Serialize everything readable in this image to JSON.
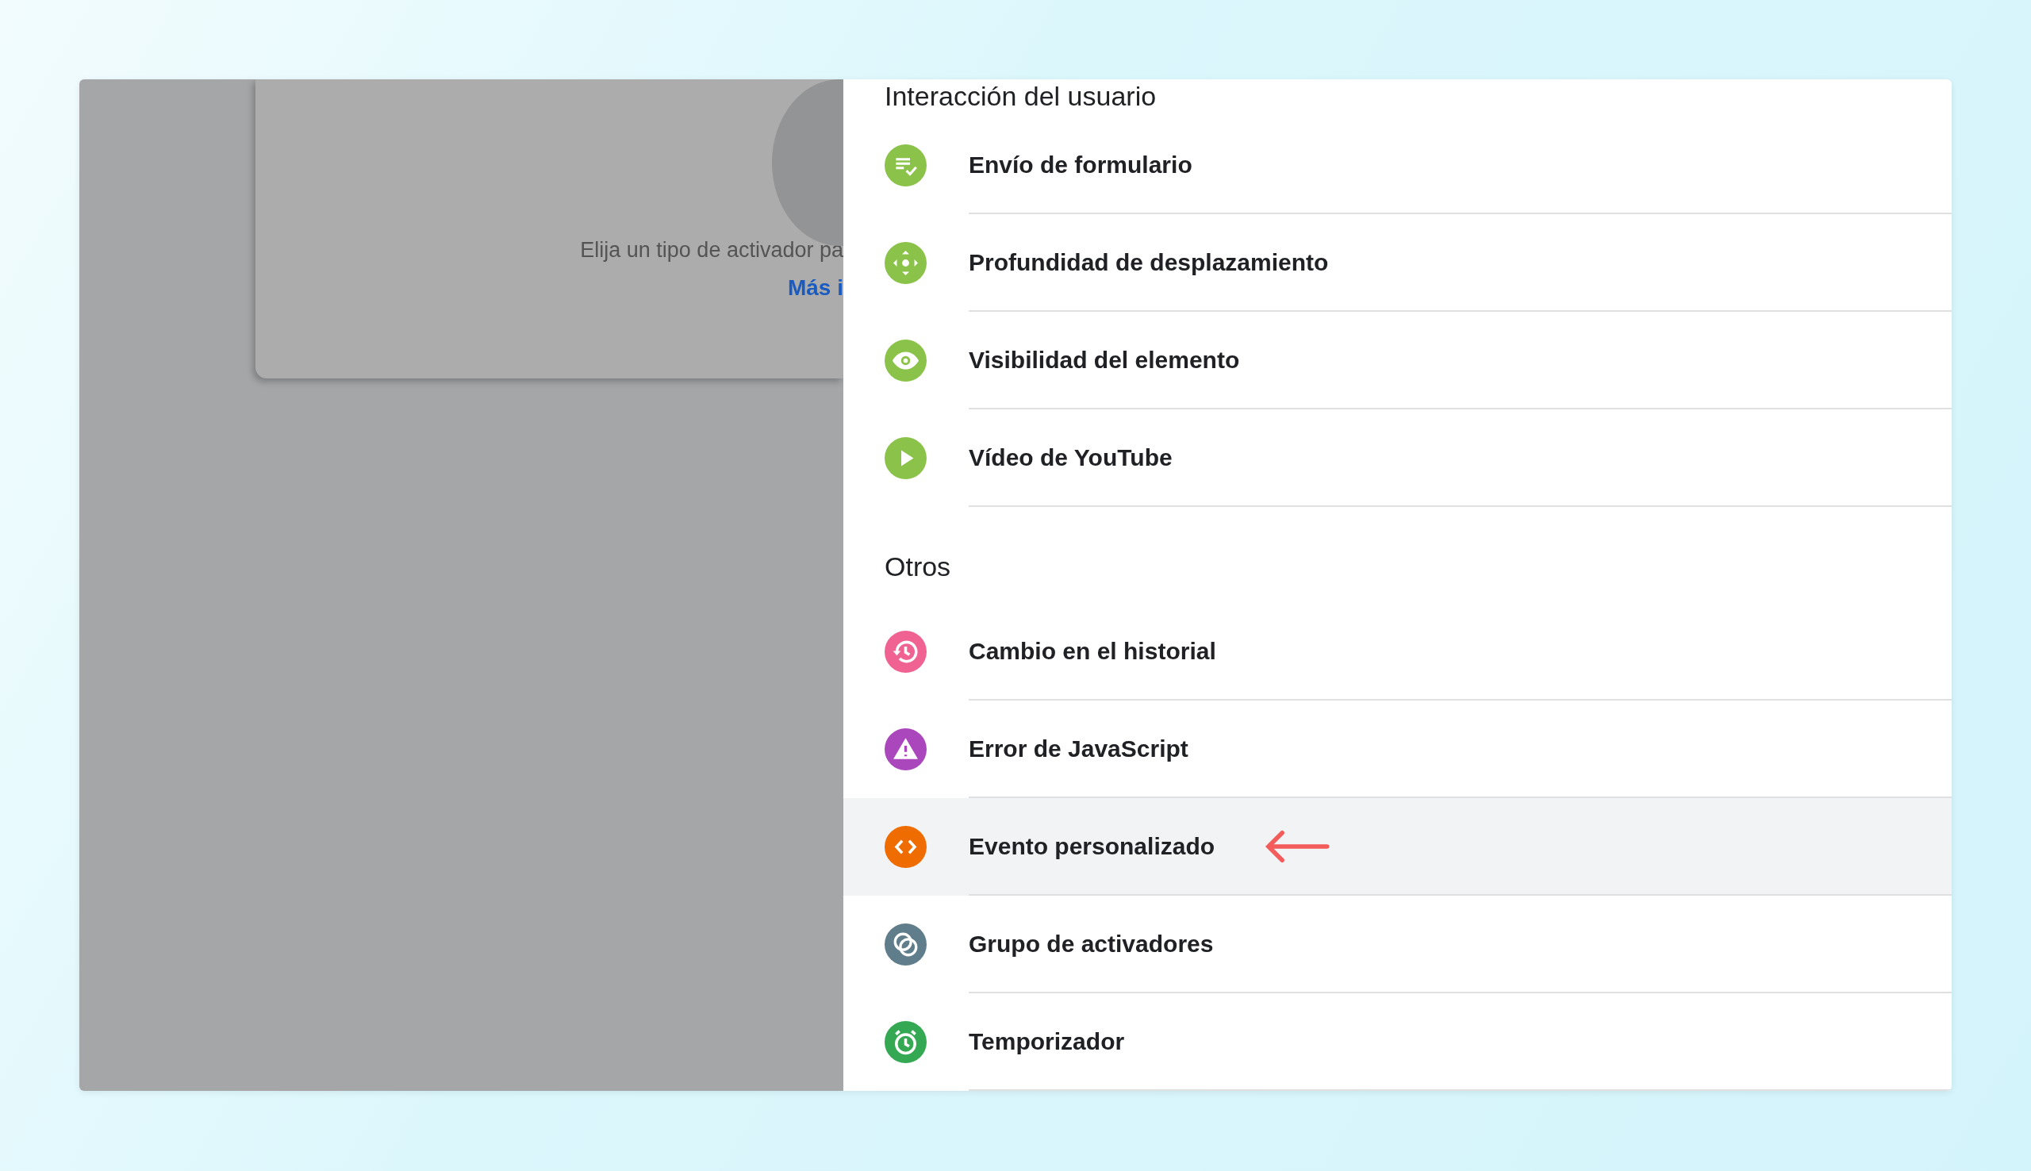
{
  "background_card": {
    "text": "Elija un tipo de activador pa",
    "link": "Más i"
  },
  "sections": [
    {
      "title": "Interacción del usuario",
      "items": [
        {
          "label": "Envío de formulario",
          "kind": "form",
          "color": "#8bc34a",
          "selected": false,
          "arrow": false
        },
        {
          "label": "Profundidad de desplazamiento",
          "kind": "scroll",
          "color": "#8bc34a",
          "selected": false,
          "arrow": false
        },
        {
          "label": "Visibilidad del elemento",
          "kind": "visibility",
          "color": "#8bc34a",
          "selected": false,
          "arrow": false
        },
        {
          "label": "Vídeo de YouTube",
          "kind": "video",
          "color": "#8bc34a",
          "selected": false,
          "arrow": false
        }
      ]
    },
    {
      "title": "Otros",
      "items": [
        {
          "label": "Cambio en el historial",
          "kind": "history",
          "color": "#f06292",
          "selected": false,
          "arrow": false
        },
        {
          "label": "Error de JavaScript",
          "kind": "error",
          "color": "#ab47bc",
          "selected": false,
          "arrow": false
        },
        {
          "label": "Evento personalizado",
          "kind": "custom",
          "color": "#ef6c00",
          "selected": true,
          "arrow": true
        },
        {
          "label": "Grupo de activadores",
          "kind": "group",
          "color": "#607d8b",
          "selected": false,
          "arrow": false
        },
        {
          "label": "Temporizador",
          "kind": "timer",
          "color": "#34a853",
          "selected": false,
          "arrow": false
        }
      ]
    }
  ]
}
